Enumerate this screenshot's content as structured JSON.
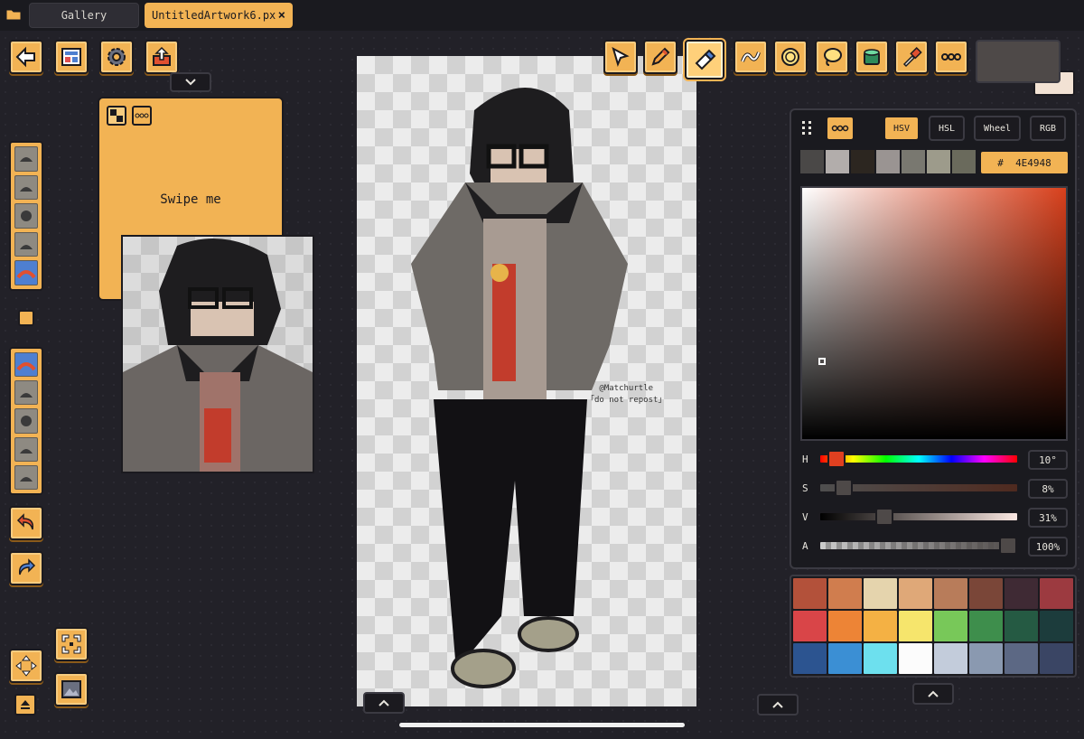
{
  "tabs": {
    "gallery": "Gallery",
    "document": "UntitledArtwork6.px",
    "close": "×"
  },
  "note": {
    "text": "Swipe me"
  },
  "canvas": {
    "signature_line1": "@Matchurtle",
    "signature_line2": "「do not repost」"
  },
  "color_panel": {
    "modes": [
      "HSV",
      "HSL",
      "Wheel",
      "RGB"
    ],
    "active_mode": "HSV",
    "hex_label": "#",
    "hex": "4E4948",
    "recent_colors": [
      "#4a4847",
      "#b2adab",
      "#2c2620",
      "#9a9492",
      "#797870",
      "#9d9b8b",
      "#6a6a5c"
    ],
    "sliders": [
      {
        "label": "H",
        "value": "10°",
        "fraction": 0.04
      },
      {
        "label": "S",
        "value": "8%",
        "fraction": 0.08
      },
      {
        "label": "V",
        "value": "31%",
        "fraction": 0.31
      },
      {
        "label": "A",
        "value": "100%",
        "fraction": 1.0
      }
    ],
    "current_color": "#4e4948",
    "previous_color": "#f2e2d4"
  },
  "palette": [
    "#b3513a",
    "#d07d4e",
    "#e5d4ad",
    "#dfa878",
    "#b87c5a",
    "#7a4638",
    "#3f2a34",
    "#9c3a40",
    "#d94548",
    "#ed8436",
    "#f4b144",
    "#f6e56c",
    "#78c859",
    "#3e8e4c",
    "#255a43",
    "#1c3c3c",
    "#2c5490",
    "#3b8fd4",
    "#6de0ee",
    "#fcfcfc",
    "#c3ccdb",
    "#8a99b0",
    "#5c6884",
    "#3a4564"
  ],
  "colors": {
    "accent": "#f2b354",
    "background": "#222128",
    "panel": "#1a1a1f"
  },
  "icons": {
    "toolbar_right": [
      "select-arrow-icon",
      "pencil-icon",
      "eraser-icon",
      "line-icon",
      "shape-icon",
      "lasso-icon",
      "fill-bucket-icon",
      "eyedropper-icon",
      "more-icon"
    ],
    "toolbar_left": [
      "back-icon",
      "gallery-icon",
      "settings-icon",
      "export-icon"
    ]
  }
}
